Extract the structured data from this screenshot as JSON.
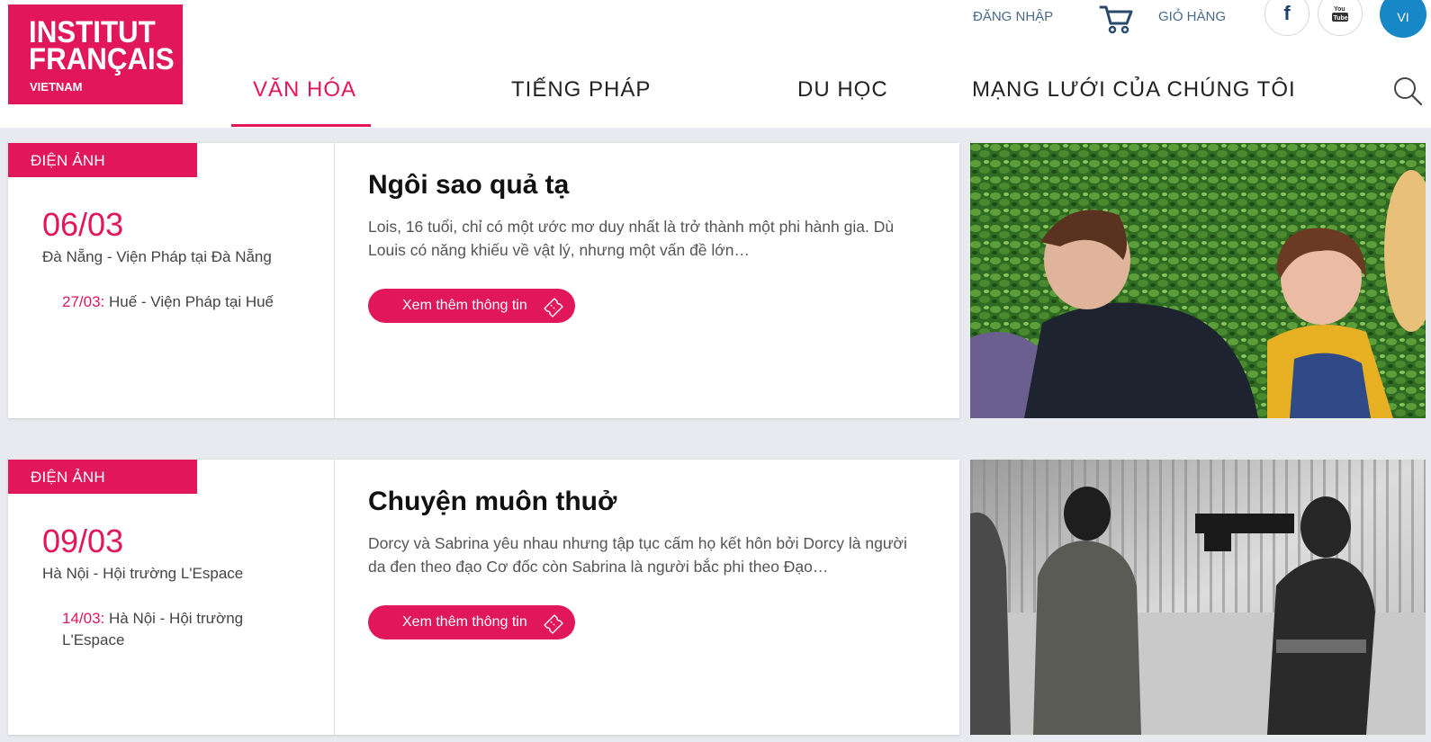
{
  "brand": {
    "line1": "INSTITUT",
    "line2": "FRANÇAIS",
    "line3": "VIETNAM",
    "color": "#e2175b"
  },
  "topbar": {
    "login": "ĐĂNG NHẬP",
    "cart_label": "GIỎ HÀNG",
    "facebook": "f",
    "youtube": "You Tube",
    "language": "VI"
  },
  "nav": {
    "items": [
      {
        "label": "VĂN HÓA",
        "active": true
      },
      {
        "label": "TIẾNG PHÁP"
      },
      {
        "label": "DU HỌC"
      },
      {
        "label": "MẠNG LƯỚI CỦA CHÚNG TÔI"
      }
    ]
  },
  "events": [
    {
      "category": "ĐIỆN ẢNH",
      "date": "06/03",
      "place": "Đà Nẵng - Viện Pháp tại Đà Nẵng",
      "other_date": "27/03:",
      "other_place": " Huế - Viện Pháp tại Huế",
      "title": "Ngôi sao quả tạ",
      "description": "Lois, 16 tuổi, chỉ có một ước mơ duy nhất là trở thành một phi hành gia. Dù Louis có năng khiếu về vật lý, nhưng một vấn đề lớn…",
      "button": "Xem thêm thông tin"
    },
    {
      "category": "ĐIỆN ẢNH",
      "date": "09/03",
      "place": "Hà Nội - Hội trường L'Espace",
      "other_date": "14/03:",
      "other_place": " Hà Nội - Hội trường L'Espace",
      "title": "Chuyện muôn thuở",
      "description": "Dorcy và Sabrina yêu nhau nhưng tập tục cấm họ kết hôn bởi Dorcy là người da đen theo đạo Cơ đốc còn Sabrina là người bắc phi theo Đạo…",
      "button": "Xem thêm thông tin"
    }
  ]
}
